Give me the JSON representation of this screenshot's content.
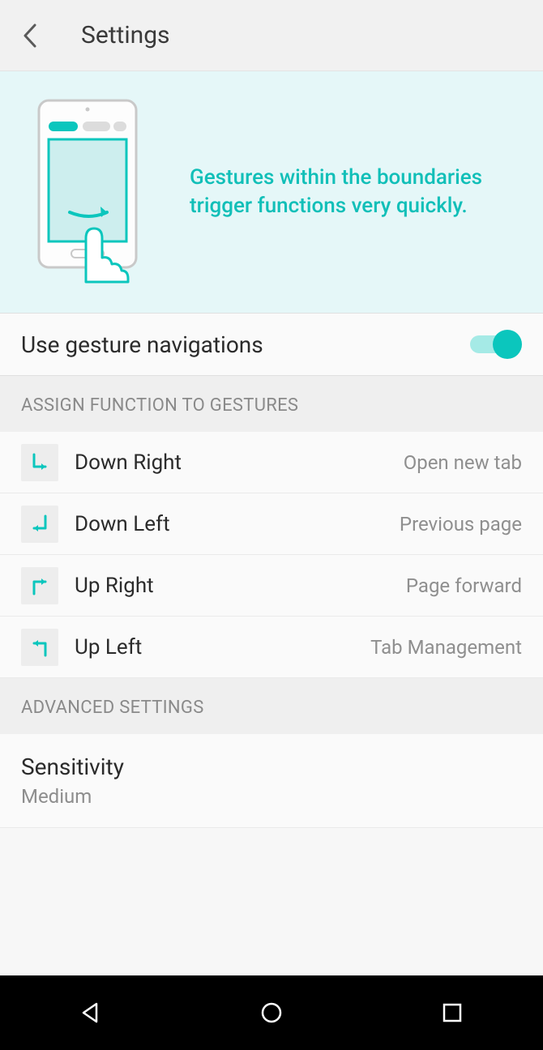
{
  "header": {
    "title": "Settings"
  },
  "hero": {
    "text": "Gestures within the boundaries trigger functions very quickly."
  },
  "toggle": {
    "label": "Use gesture navigations",
    "on": true
  },
  "section1": {
    "header": "ASSIGN FUNCTION TO GESTURES"
  },
  "gestures": [
    {
      "label": "Down Right",
      "value": "Open new tab"
    },
    {
      "label": "Down Left",
      "value": "Previous page"
    },
    {
      "label": "Up Right",
      "value": "Page forward"
    },
    {
      "label": "Up Left",
      "value": "Tab Management"
    }
  ],
  "section2": {
    "header": "ADVANCED SETTINGS"
  },
  "sensitivity": {
    "label": "Sensitivity",
    "value": "Medium"
  },
  "colors": {
    "accent": "#0bc6bd"
  }
}
